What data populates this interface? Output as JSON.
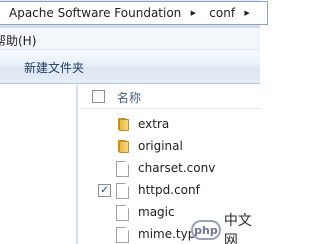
{
  "breadcrumb": {
    "items": [
      "Apache Software Foundation",
      "conf"
    ]
  },
  "menu": {
    "visible_item": "帮助(H)"
  },
  "toolbar": {
    "new_folder_label": "新建文件夹"
  },
  "file_list": {
    "column_name": "名称",
    "header_checked": false,
    "rows": [
      {
        "name": "extra",
        "type": "folder",
        "checked": false,
        "icon": "folder-icon"
      },
      {
        "name": "original",
        "type": "folder",
        "checked": false,
        "icon": "folder-icon"
      },
      {
        "name": "charset.conv",
        "type": "file",
        "checked": false,
        "icon": "file-icon"
      },
      {
        "name": "httpd.conf",
        "type": "file",
        "checked": true,
        "icon": "file-icon"
      },
      {
        "name": "magic",
        "type": "file",
        "checked": false,
        "icon": "file-icon"
      },
      {
        "name": "mime.types",
        "type": "file",
        "checked": false,
        "icon": "file-icon"
      }
    ]
  },
  "watermark": {
    "logo_text": "php",
    "text": "中文网"
  },
  "colors": {
    "address_bar_bg": "#dde9f6",
    "toolbar_text": "#1e3a5f",
    "folder": "#e8b94a",
    "checkmark": "#1f3f8a"
  }
}
